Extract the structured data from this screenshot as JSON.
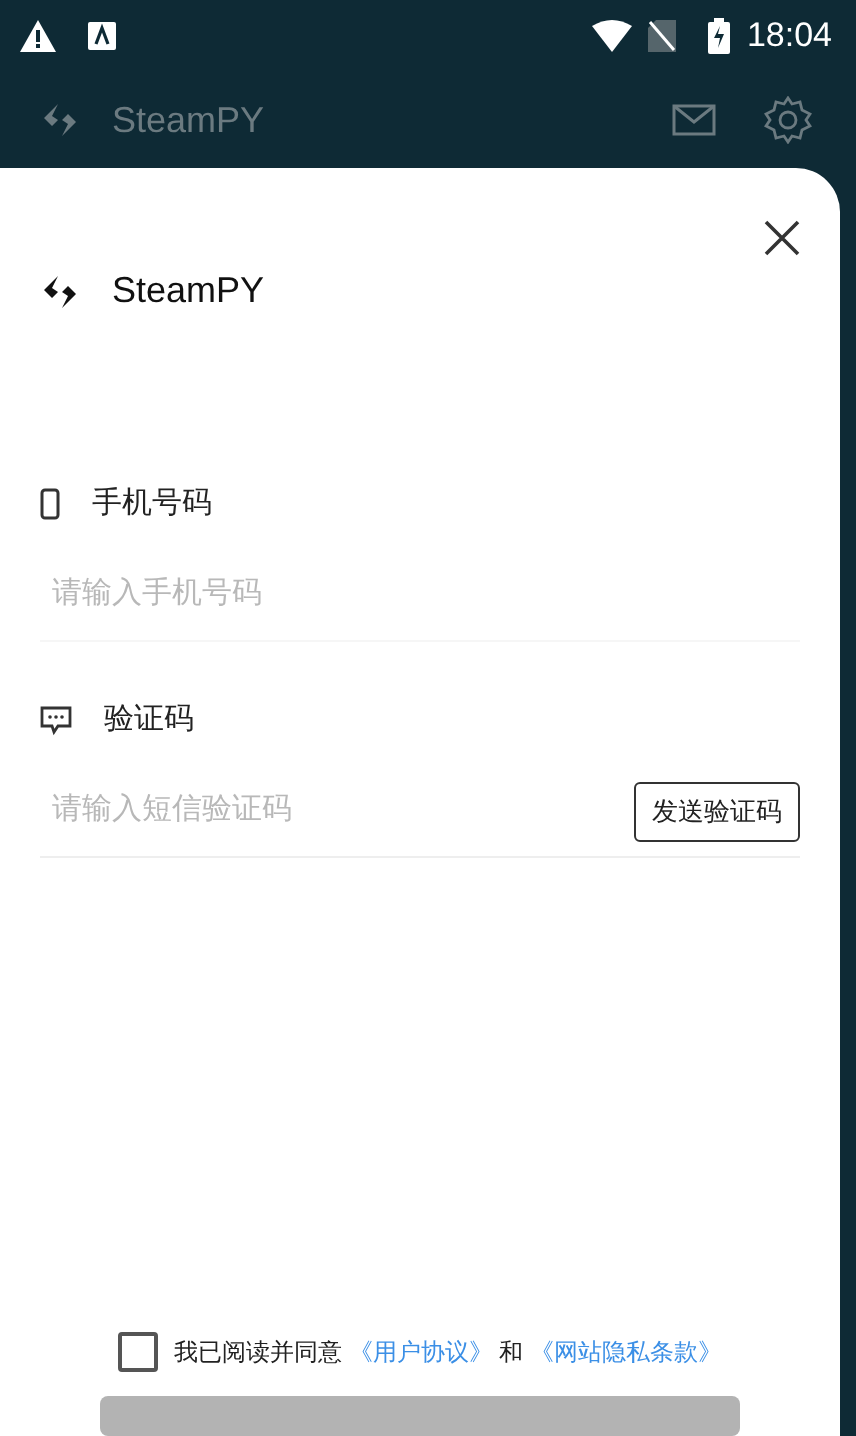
{
  "status_bar": {
    "time": "18:04"
  },
  "app_bar": {
    "title": "SteamPY"
  },
  "sheet": {
    "brand": "SteamPY",
    "fields": [
      {
        "kind": "phone",
        "label": "手机号码",
        "placeholder": "请输入手机号码"
      },
      {
        "kind": "code",
        "label": "验证码",
        "placeholder": "请输入短信验证码",
        "button": "发送验证码"
      }
    ],
    "agreement": {
      "checked": false,
      "parts": [
        {
          "kind": "text",
          "text": "我已阅读并同意"
        },
        {
          "kind": "link",
          "text": "《用户协议》"
        },
        {
          "kind": "text",
          "text": "和"
        },
        {
          "kind": "link",
          "text": "《网站隐私条款》"
        }
      ]
    },
    "submit": {
      "disabled": true
    }
  }
}
